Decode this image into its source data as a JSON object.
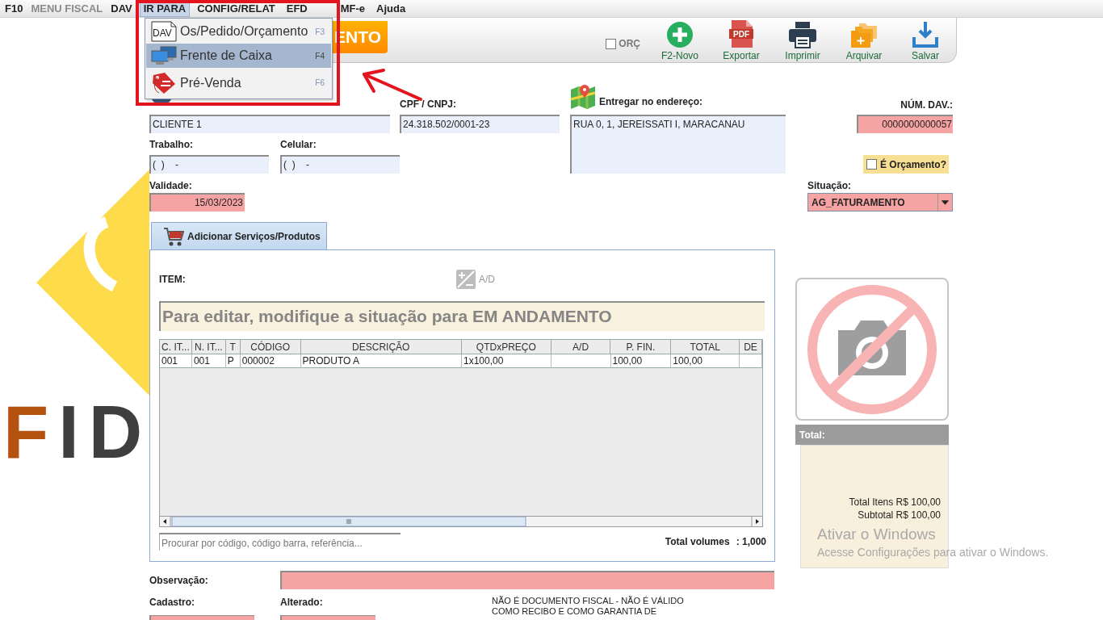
{
  "menu_bar": [
    {
      "label": "F10",
      "selected": false,
      "disabled": false
    },
    {
      "label": "MENU FISCAL",
      "selected": false,
      "disabled": true
    },
    {
      "label": "DAV",
      "selected": false,
      "disabled": false
    },
    {
      "label": "IR PARA",
      "selected": true,
      "disabled": false
    },
    {
      "label": "CONFIG/RELAT",
      "selected": false,
      "disabled": false
    },
    {
      "label": "EFD",
      "selected": false,
      "disabled": false
    },
    {
      "label": "MF-e",
      "selected": false,
      "disabled": false
    },
    {
      "label": "Ajuda",
      "selected": false,
      "disabled": false
    }
  ],
  "dropdown": {
    "items": [
      {
        "kind": "document",
        "icon_text": "DAV",
        "label": "Os/Pedido/Orçamento",
        "shortcut": "F3",
        "selected": false
      },
      {
        "kind": "computers",
        "label": "Frente de Caixa",
        "shortcut": "F4",
        "selected": true
      },
      {
        "kind": "tag",
        "label": "Pré-Venda",
        "shortcut": "F6",
        "selected": false
      }
    ]
  },
  "title_banner": {
    "text": "ENTO"
  },
  "toolbar": {
    "orc_checkbox": {
      "label": "ORÇ",
      "checked": false
    },
    "buttons": [
      {
        "kind": "new",
        "label": "F2-Novo"
      },
      {
        "kind": "pdf",
        "icon_text": "PDF",
        "label": "Exportar"
      },
      {
        "kind": "print",
        "label": "Imprimir"
      },
      {
        "kind": "archive",
        "label": "Arquivar"
      },
      {
        "kind": "save",
        "label": "Salvar"
      }
    ]
  },
  "customer": {
    "name": {
      "value": "CLIENTE 1",
      "highlighted": false
    },
    "cpf_cnpj": {
      "label": "CPF / CNPJ:",
      "value": "24.318.502/0001-23",
      "highlighted": false
    },
    "delivery_address": {
      "label": "Entregar no endereço:",
      "value": "RUA 0, 1, JEREISSATI I, MARACANAU",
      "highlighted": false
    },
    "phone_work": {
      "label": "Trabalho:",
      "value": "(  )    -",
      "highlighted": false
    },
    "phone_mobile": {
      "label": "Celular:",
      "value": "(  )    -",
      "highlighted": false
    },
    "validity": {
      "label": "Validade:",
      "value": "15/03/2023",
      "highlighted": true
    }
  },
  "document": {
    "number": {
      "label": "NÚM. DAV.:",
      "value": "0000000000057",
      "highlighted": true
    },
    "is_quote": {
      "label": "É Orçamento?",
      "checked": false
    },
    "status": {
      "label": "Situação:",
      "value": "AG_FATURAMENTO",
      "highlighted": true
    }
  },
  "tabs": [
    {
      "label": "Adicionar Serviços/Produtos",
      "selected": true
    }
  ],
  "items_panel": {
    "item_label": "ITEM:",
    "ad_button": "A/D",
    "notice": "Para editar, modifique a situação para EM ANDAMENTO",
    "table": {
      "columns": [
        "C. IT...",
        "N. IT...",
        "T",
        "CÓDIGO",
        "DESCRIÇÃO",
        "QTDxPREÇO",
        "A/D",
        "P. FIN.",
        "TOTAL",
        "DE"
      ],
      "rows": [
        [
          "001",
          "001",
          "P",
          "000002",
          "PRODUTO A",
          "1x100,00",
          null,
          "100,00",
          "100,00",
          null
        ]
      ]
    },
    "search": {
      "placeholder": "Procurar por código, código barra, referência..."
    },
    "total_volumes": {
      "label": "Total volumes",
      "value": ": 1,000"
    }
  },
  "totals": {
    "title": "Total:",
    "lines": [
      "Total Itens R$ 100,00",
      "Subtotal R$ 100,00"
    ]
  },
  "footer": {
    "observation": {
      "label": "Observação:",
      "highlighted": true
    },
    "created": {
      "label": "Cadastro:",
      "highlighted": true
    },
    "changed": {
      "label": "Alterado:",
      "highlighted": true
    },
    "disclaimer": [
      "NÃO É DOCUMENTO FISCAL - NÃO É VÁLIDO",
      "COMO RECIBO E COMO GARANTIA DE"
    ]
  },
  "logo": {
    "text": "FID"
  },
  "windows_activation": {
    "title": "Ativar o Windows",
    "message": "Acesse Configurações para ativar o Windows."
  }
}
